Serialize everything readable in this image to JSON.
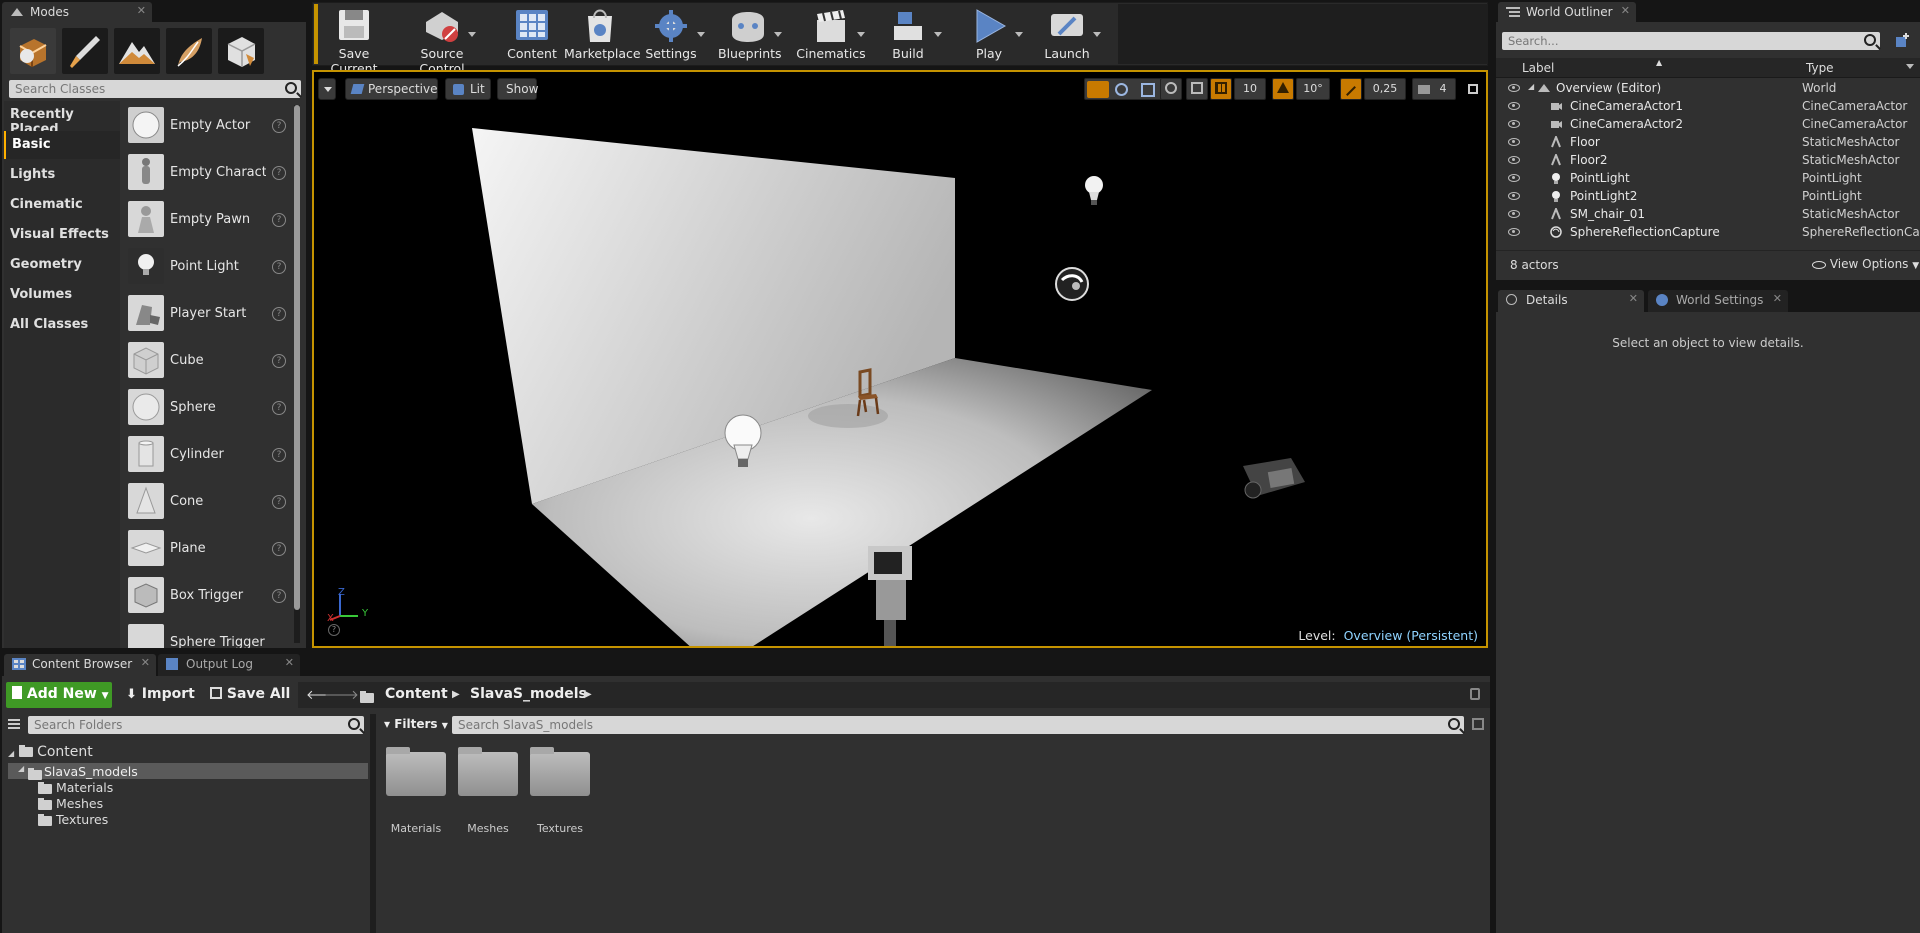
{
  "modes": {
    "tab_title": "Modes",
    "search_placeholder": "Search Classes",
    "mode_buttons": [
      "place-mode",
      "paint-mode",
      "landscape-mode",
      "foliage-mode",
      "geometry-mode"
    ],
    "categories": [
      "Recently Placed",
      "Basic",
      "Lights",
      "Cinematic",
      "Visual Effects",
      "Geometry",
      "Volumes",
      "All Classes"
    ],
    "active_category": "Basic",
    "items": [
      "Empty Actor",
      "Empty Character",
      "Empty Pawn",
      "Point Light",
      "Player Start",
      "Cube",
      "Sphere",
      "Cylinder",
      "Cone",
      "Plane",
      "Box Trigger",
      "Sphere Trigger"
    ],
    "help_glyph": "?"
  },
  "toolbar": {
    "buttons": [
      {
        "label": "Save Current",
        "icon": "save-icon"
      },
      {
        "label": "Source Control",
        "icon": "source-control-icon"
      },
      {
        "label": "Content",
        "icon": "content-icon"
      },
      {
        "label": "Marketplace",
        "icon": "marketplace-icon"
      },
      {
        "label": "Settings",
        "icon": "settings-icon"
      },
      {
        "label": "Blueprints",
        "icon": "blueprints-icon"
      },
      {
        "label": "Cinematics",
        "icon": "cinematics-icon"
      },
      {
        "label": "Build",
        "icon": "build-icon"
      },
      {
        "label": "Play",
        "icon": "play-icon"
      },
      {
        "label": "Launch",
        "icon": "launch-icon"
      }
    ]
  },
  "viewport": {
    "perspective": "Perspective",
    "lit": "Lit",
    "show": "Show",
    "grid_snap": "10",
    "rotation_snap": "10°",
    "scale_snap": "0,25",
    "camera_speed": "4",
    "level_label": "Level:",
    "level_name": "Overview (Persistent)",
    "axis_x": "X",
    "axis_y": "Y",
    "axis_z": "Z"
  },
  "outliner": {
    "tab_title": "World Outliner",
    "search_placeholder": "Search...",
    "col_label": "Label",
    "col_type": "Type",
    "rows": [
      {
        "label": "Overview (Editor)",
        "type": "World"
      },
      {
        "label": "CineCameraActor1",
        "type": "CineCameraActor"
      },
      {
        "label": "CineCameraActor2",
        "type": "CineCameraActor"
      },
      {
        "label": "Floor",
        "type": "StaticMeshActor"
      },
      {
        "label": "Floor2",
        "type": "StaticMeshActor"
      },
      {
        "label": "PointLight",
        "type": "PointLight"
      },
      {
        "label": "PointLight2",
        "type": "PointLight"
      },
      {
        "label": "SM_chair_01",
        "type": "StaticMeshActor"
      },
      {
        "label": "SphereReflectionCapture",
        "type": "SphereReflectionCapture"
      }
    ],
    "actor_count": "8 actors",
    "view_options": "View Options"
  },
  "details": {
    "tab_details": "Details",
    "tab_world_settings": "World Settings",
    "empty_message": "Select an object to view details."
  },
  "content_browser": {
    "tab_title": "Content Browser",
    "tab_output_log": "Output Log",
    "add_new": "Add New",
    "import": "Import",
    "save_all": "Save All",
    "breadcrumb": [
      "Content",
      "SlavaS_models"
    ],
    "search_folders_placeholder": "Search Folders",
    "filters": "Filters",
    "search_assets_placeholder": "Search SlavaS_models",
    "tree": {
      "root": "Content",
      "selected": "SlavaS_models",
      "children": [
        "Materials",
        "Meshes",
        "Textures"
      ]
    },
    "folders": [
      "Materials",
      "Meshes",
      "Textures"
    ]
  }
}
